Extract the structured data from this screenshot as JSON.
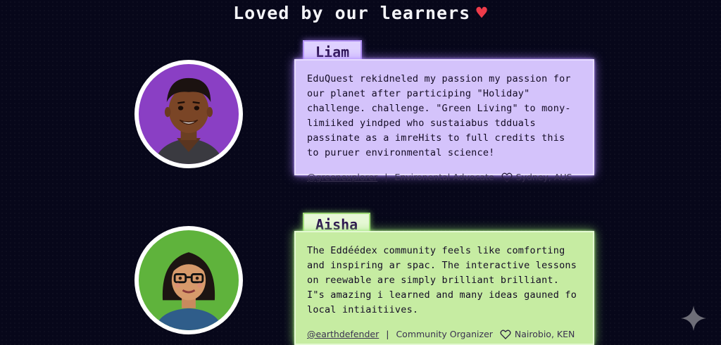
{
  "heading": {
    "text": "Loved by our learners",
    "heart_icon": "pixel-heart-icon",
    "heart_color": "#ee3b4a"
  },
  "testimonials": [
    {
      "name": "Liam",
      "theme": "purple",
      "quote": "EduQuest rekidneled my passion my passion for our planet after participing \"Holiday\" challenge. challenge. \"Green Living\" to mony-limiiked yindped who sustaiabus tdduals passinate as a imreHits to full credits this to puruer environmental science!",
      "handle": "@greenexplorer",
      "role": "Environental Advocate",
      "location": "Sydney, AUS",
      "card_color": "#d4c3fb"
    },
    {
      "name": "Aisha",
      "theme": "green",
      "quote": "The Eddéédex community feels like comforting and inspiring ar spac. The interactive lessons on reewable are simply brilliant brilliant. I\"s amazing i learned and many ideas gauned fo local intiaitiives.",
      "handle": "@earthdefender",
      "role": "Community Organizer",
      "location": "Nairobio, KEN",
      "card_color": "#c6eca2"
    }
  ],
  "corner_icon": "sparkle-icon"
}
